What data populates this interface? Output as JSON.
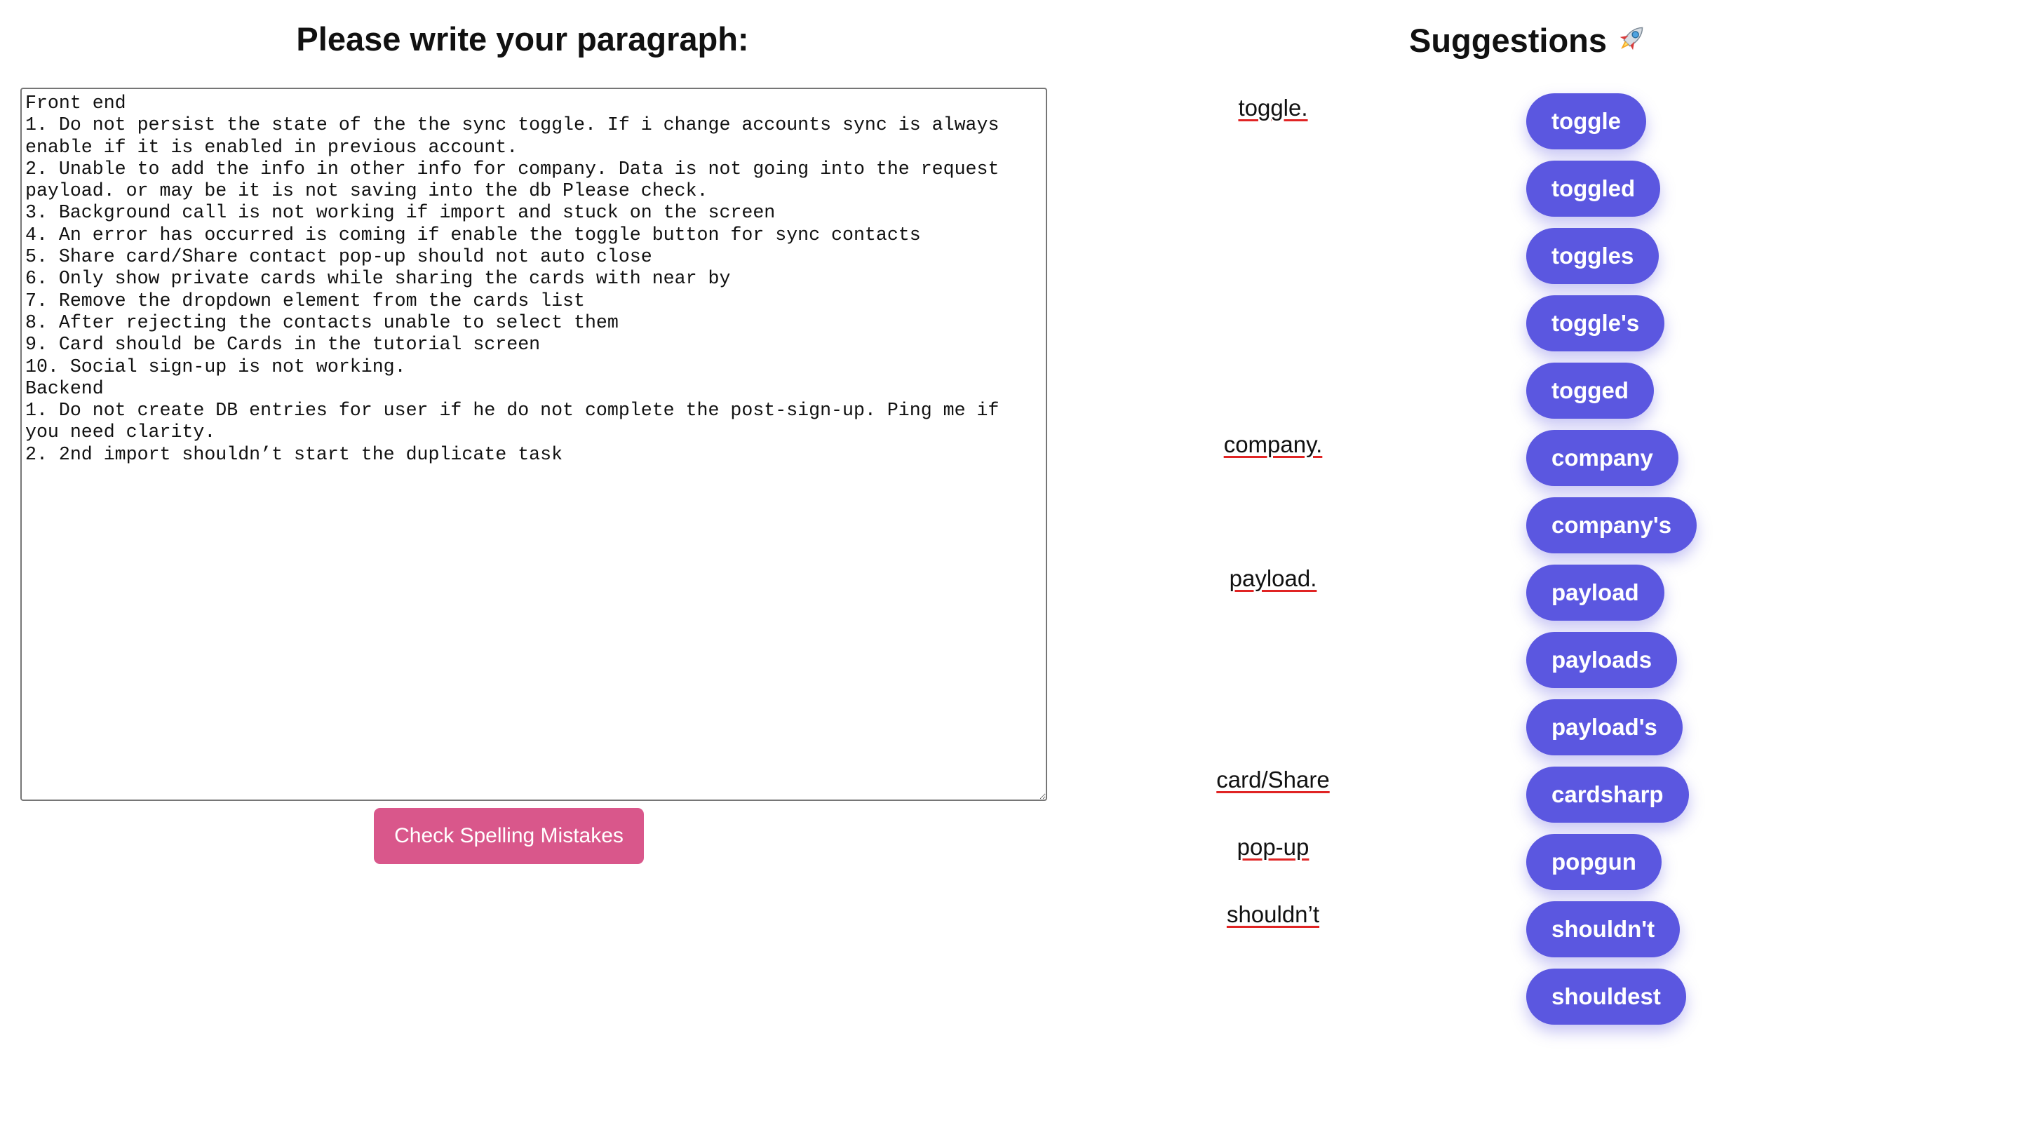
{
  "left_heading": "Please write your paragraph:",
  "right_heading": "Suggestions",
  "right_heading_icon": "rocket-icon",
  "editor_text": "Front end\n1. Do not persist the state of the the sync toggle. If i change accounts sync is always enable if it is enabled in previous account.\n2. Unable to add the info in other info for company. Data is not going into the request payload. or may be it is not saving into the db Please check.\n3. Background call is not working if import and stuck on the screen\n4. An error has occurred is coming if enable the toggle button for sync contacts\n5. Share card/Share contact pop-up should not auto close\n6. Only show private cards while sharing the cards with near by\n7. Remove the dropdown element from the cards list\n8. After rejecting the contacts unable to select them\n9. Card should be Cards in the tutorial screen\n10. Social sign-up is not working.\nBackend\n1. Do not create DB entries for user if he do not complete the post-sign-up. Ping me if you need clarity.\n2. 2nd import shouldn’t start the duplicate task",
  "check_button_label": "Check Spelling Mistakes",
  "mistakes": [
    "toggle.",
    "company.",
    "payload.",
    "card/Share",
    "pop-up",
    "shouldn’t"
  ],
  "suggestions": [
    "toggle",
    "toggled",
    "toggles",
    "toggle's",
    "togged",
    "company",
    "company's",
    "payload",
    "payloads",
    "payload's",
    "cardsharp",
    "popgun",
    "shouldn't",
    "shouldest"
  ],
  "colors": {
    "button_pink": "#d9578b",
    "chip_purple": "#5b57e0",
    "underline_red": "#e02424"
  }
}
